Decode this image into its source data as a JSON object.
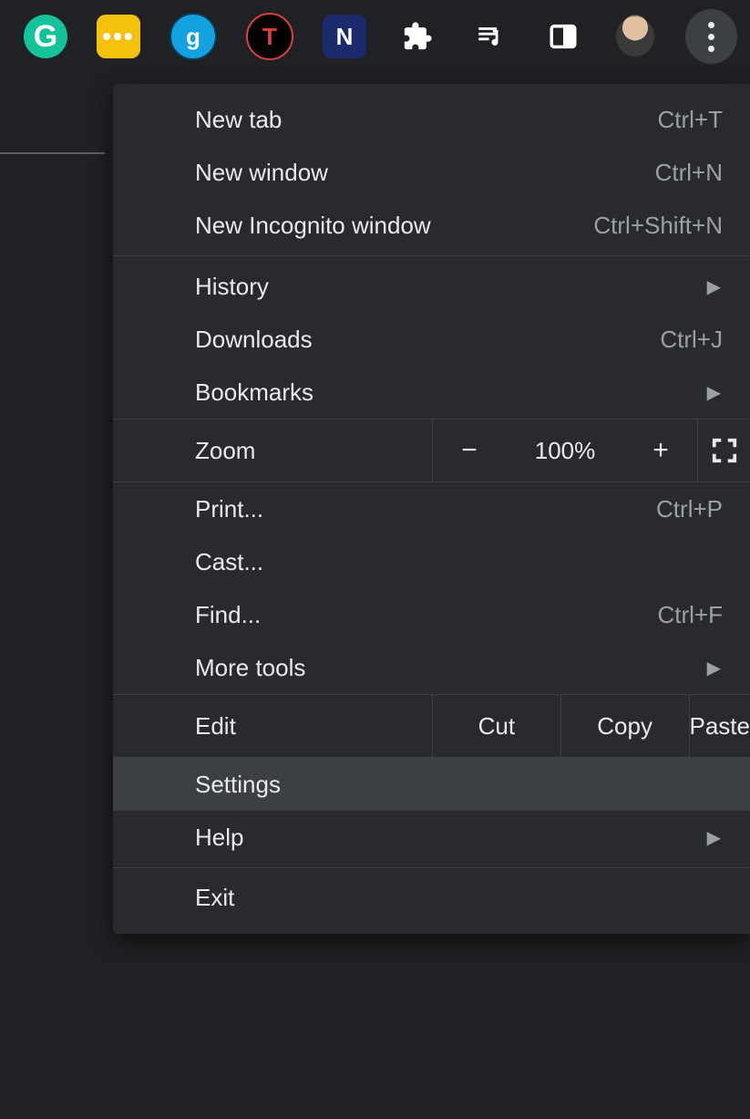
{
  "toolbar": {
    "ext_grammarly_letter": "G",
    "ext_g_letter": "g",
    "ext_t_letter": "T",
    "ext_n_letter": "N"
  },
  "menu": {
    "new_tab": {
      "label": "New tab",
      "shortcut": "Ctrl+T"
    },
    "new_window": {
      "label": "New window",
      "shortcut": "Ctrl+N"
    },
    "new_incognito": {
      "label": "New Incognito window",
      "shortcut": "Ctrl+Shift+N"
    },
    "history": {
      "label": "History"
    },
    "downloads": {
      "label": "Downloads",
      "shortcut": "Ctrl+J"
    },
    "bookmarks": {
      "label": "Bookmarks"
    },
    "zoom": {
      "label": "Zoom",
      "value": "100%"
    },
    "print": {
      "label": "Print...",
      "shortcut": "Ctrl+P"
    },
    "cast": {
      "label": "Cast..."
    },
    "find": {
      "label": "Find...",
      "shortcut": "Ctrl+F"
    },
    "more_tools": {
      "label": "More tools"
    },
    "edit": {
      "label": "Edit",
      "cut": "Cut",
      "copy": "Copy",
      "paste": "Paste"
    },
    "settings": {
      "label": "Settings"
    },
    "help": {
      "label": "Help"
    },
    "exit": {
      "label": "Exit"
    }
  }
}
